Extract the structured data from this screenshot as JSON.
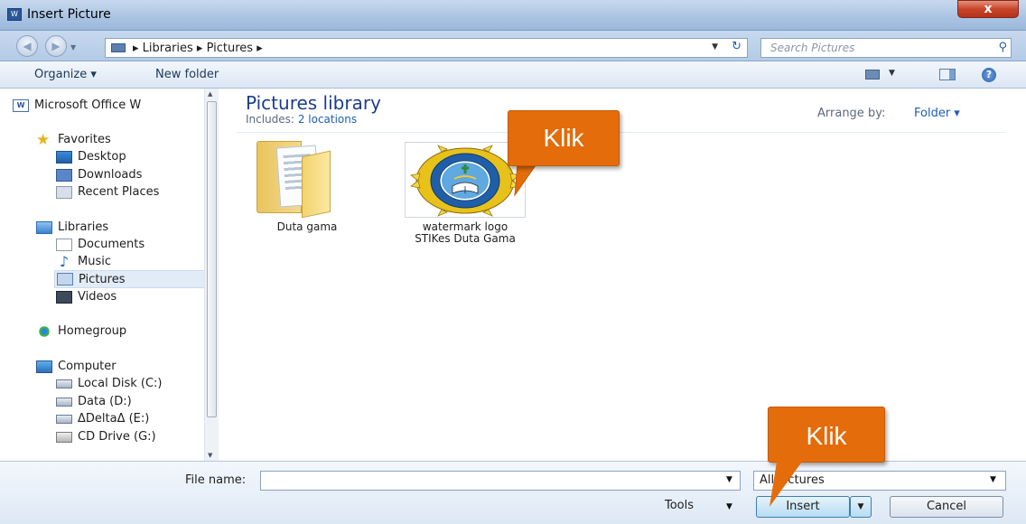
{
  "window": {
    "title": "Insert Picture",
    "close_glyph": "x"
  },
  "address": {
    "path": "▸ Libraries ▸ Pictures ▸",
    "search_placeholder": "Search Pictures"
  },
  "toolbar": {
    "organize": "Organize ▾",
    "new_folder": "New folder"
  },
  "navpane": {
    "office": "Microsoft Office W",
    "favorites": "Favorites",
    "desktop": "Desktop",
    "downloads": "Downloads",
    "recent": "Recent Places",
    "libraries": "Libraries",
    "documents": "Documents",
    "music": "Music",
    "pictures": "Pictures",
    "videos": "Videos",
    "homegroup": "Homegroup",
    "computer": "Computer",
    "local_disk": "Local Disk (C:)",
    "data": "Data (D:)",
    "delta": "ΔDeltaΔ (E:)",
    "cd": "CD Drive (G:)"
  },
  "content": {
    "title": "Pictures library",
    "includes_label": "Includes:",
    "includes_link": "2 locations",
    "arrange_label": "Arrange by:",
    "arrange_value": "Folder ▾",
    "items": [
      {
        "label": "Duta gama",
        "icon": "folder-icon"
      },
      {
        "label": "watermark logo STIKes Duta Gama",
        "icon": "image-thumbnail"
      }
    ]
  },
  "callouts": {
    "first": "Klik",
    "second": "Klik"
  },
  "bottom": {
    "file_name_label": "File name:",
    "file_name_value": "",
    "filter_value": "All Pictures",
    "tools": "Tools",
    "insert": "Insert",
    "cancel": "Cancel"
  },
  "colors": {
    "callout": "#e46c0a",
    "title_blue": "#1e3d8a",
    "link_blue": "#1c5fb4"
  }
}
